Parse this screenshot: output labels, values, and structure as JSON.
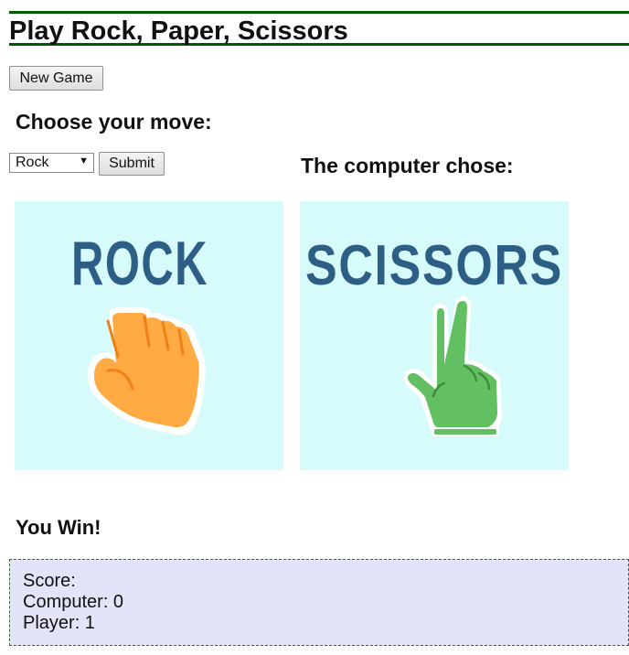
{
  "page": {
    "title": "Play Rock, Paper, Scissors"
  },
  "controls": {
    "new_game_label": "New Game",
    "choose_heading": "Choose your move:",
    "selected_move": "Rock",
    "submit_label": "Submit"
  },
  "computer": {
    "heading": "The computer chose:"
  },
  "cards": {
    "player": {
      "label": "ROCK",
      "icon": "fist-icon",
      "hand_color": "#ffaa42",
      "text_color": "#2d5e86"
    },
    "computer": {
      "label": "SCISSORS",
      "icon": "peace-hand-icon",
      "hand_color": "#62bf62",
      "text_color": "#2d5e86"
    },
    "background_color": "#d7fbfa"
  },
  "result": {
    "text": "You Win!"
  },
  "score": {
    "heading": "Score:",
    "computer_line": "Computer: 0",
    "player_line": "Player: 1"
  }
}
